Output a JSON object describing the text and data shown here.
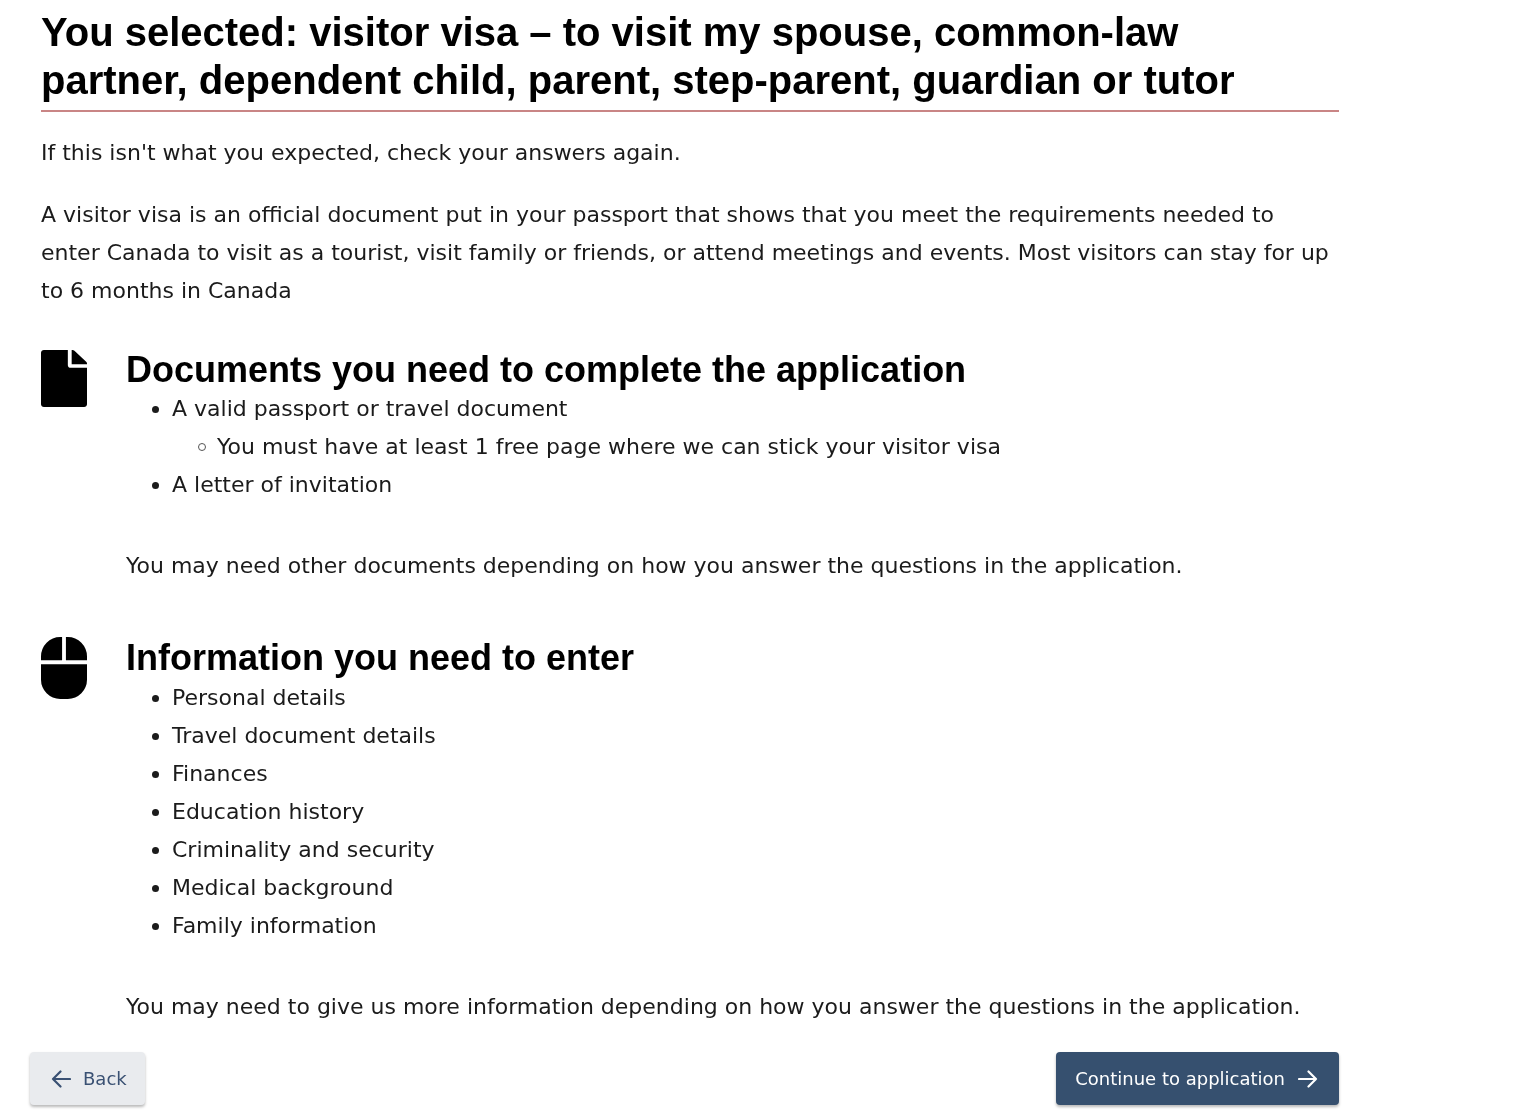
{
  "heading": "You selected: visitor visa – to visit my spouse, common-law partner, dependent child, parent, step-parent, guardian or tutor",
  "intro": "If this isn't what you expected, check your answers again.",
  "description": "A visitor visa is an official document put in your passport that shows that you meet the requirements needed to enter Canada to visit as a tourist, visit family or friends, or attend meetings and events. Most visitors can stay for up to 6 months in Canada",
  "sections": [
    {
      "kind": "document",
      "title": "Documents you need to complete the application",
      "items": [
        {
          "text": "A valid passport or travel document",
          "children": [
            {
              "text": "You must have at least 1 free page where we can stick your visitor visa"
            }
          ]
        },
        {
          "text": "A letter of invitation"
        }
      ],
      "note": "You may need other documents depending on how you answer the questions in the application."
    },
    {
      "kind": "mouse",
      "title": "Information you need to enter",
      "items": [
        {
          "text": "Personal details"
        },
        {
          "text": "Travel document details"
        },
        {
          "text": "Finances"
        },
        {
          "text": "Education history"
        },
        {
          "text": "Criminality and security"
        },
        {
          "text": "Medical background"
        },
        {
          "text": "Family information"
        }
      ],
      "note": "You may need to give us more information depending on how you answer the questions in the application."
    }
  ],
  "buttons": [
    {
      "kind": "back",
      "label": "Back"
    },
    {
      "kind": "continue",
      "label": "Continue to application"
    }
  ]
}
